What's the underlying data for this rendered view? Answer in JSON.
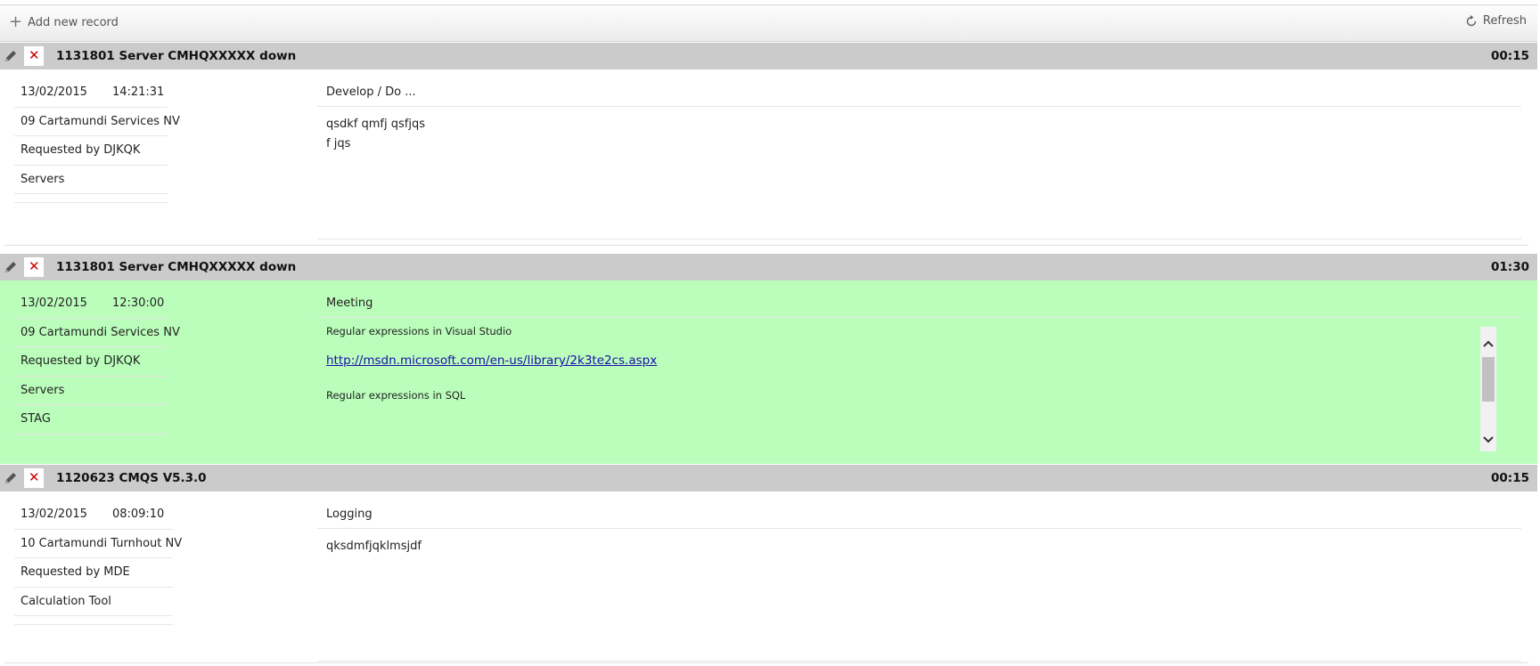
{
  "toolbar": {
    "add_label": "Add new record",
    "refresh_label": "Refresh"
  },
  "records": [
    {
      "title": "1131801 Server CMHQXXXXX down",
      "duration": "00:15",
      "date": "13/02/2015",
      "time": "14:21:31",
      "company": "09 Cartamundi Services NV",
      "requested_by": "Requested by DJKQK",
      "group": "Servers",
      "category": "Develop / Do ...",
      "description_line1": "qsdkf qmfj qsfjqs",
      "description_line2": "f jqs"
    },
    {
      "title": "1131801 Server CMHQXXXXX down",
      "duration": "01:30",
      "date": "13/02/2015",
      "time": "12:30:00",
      "company": "09 Cartamundi Services NV",
      "requested_by": "Requested by DJKQK",
      "group": "Servers",
      "tag": "STAG",
      "category": "Meeting",
      "note1": "Regular expressions in Visual Studio",
      "link": "http://msdn.microsoft.com/en-us/library/2k3te2cs.aspx",
      "note2": "Regular expressions in SQL",
      "highlight_color": "#bbfebb"
    },
    {
      "title": "1120623 CMQS V5.3.0",
      "duration": "00:15",
      "date": "13/02/2015",
      "time": "08:09:10",
      "company": "10 Cartamundi Turnhout NV",
      "requested_by": "Requested by MDE",
      "group": "Calculation Tool",
      "category": "Logging",
      "description_line1": "qksdmfjqklmsjdf"
    }
  ],
  "icons": {
    "add": "plus-icon",
    "refresh": "refresh-icon",
    "edit": "pencil-icon",
    "delete": "close-icon",
    "scroll_up": "chevron-up-icon",
    "scroll_down": "chevron-down-icon"
  },
  "colors": {
    "header_bg": "#cbcbcb",
    "delete_red": "#cc0000",
    "link_blue": "#1a0dab"
  }
}
